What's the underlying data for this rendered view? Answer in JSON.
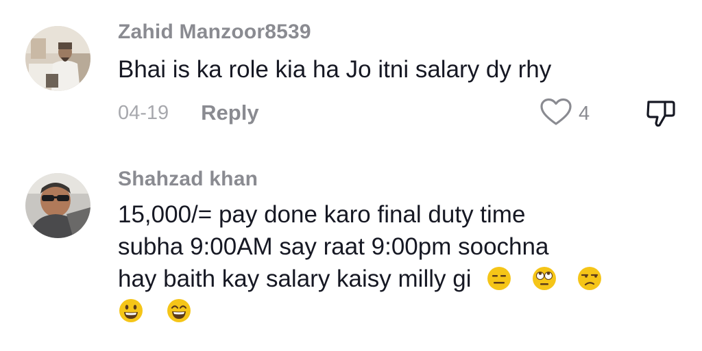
{
  "comments": [
    {
      "username": "Zahid Manzoor8539",
      "text": "Bhai is ka role kia ha Jo itni salary dy rhy",
      "date": "04-19",
      "reply_label": "Reply",
      "like_count": "4"
    },
    {
      "username": "Shahzad khan",
      "text_line1": "15,000/= pay done karo final duty time",
      "text_line2": "subha 9:00AM say raat 9:00pm soochna",
      "text_line3": "hay baith kay salary kaisy milly gi",
      "emojis": [
        "expressionless-face",
        "rolling-eyes-face",
        "unamused-face",
        "grinning-face",
        "grinning-smiling-eyes-face"
      ]
    }
  ],
  "icons": {
    "like": "heart-outline-icon",
    "dislike": "thumbs-down-outline-icon"
  },
  "colors": {
    "username": "#8a8b91",
    "text": "#161823",
    "meta": "#a7a8ad",
    "emoji": "#f5c518"
  }
}
